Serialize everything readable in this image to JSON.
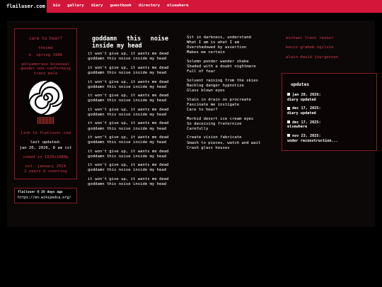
{
  "header": {
    "brand": "flailuser.com",
    "nav": [
      "bio",
      "gallery",
      "diary",
      "guestbook",
      "directory",
      "elsewhere"
    ]
  },
  "profile": {
    "tagline": "care to hear?",
    "name": "thesmd",
    "born": "b. spring 1996",
    "identity": [
      "polyamorous bisexual",
      "gender non-conforming",
      "trans male"
    ],
    "link": "link to flailuser.com",
    "last_updated_label": "last updated:",
    "last_updated": "jan 20, 2026, 8 am cst",
    "coded": "coded in 1920x1080p",
    "est": [
      "est. january 2024",
      "2 years & counting"
    ]
  },
  "chat": {
    "author": "flailuser",
    "age": "25 days ago",
    "url": "https://en.wikipedia.org/"
  },
  "poem": {
    "title": "goddamn this noise inside my head",
    "refrain_a": "it won't give up, it wants me dead",
    "refrain_b": "goddamn this noise inside my head",
    "count": 10
  },
  "lyrics": [
    [
      "Sit in darkness, understand",
      "What I am is what I am",
      "Overshadowed by assertion",
      "Makes me certain"
    ],
    [
      "Solemn ponder wander shake",
      "Shaded with a doubt nightmare",
      "Full of fear"
    ],
    [
      "Solvent raining from the skies",
      "Backlog danger hypnotize",
      "Glass blown eyes"
    ],
    [
      "Stain in drain on procreate",
      "Fascinate me instigate",
      "Care to hear?"
    ],
    [
      "Morbid desert ice cream eyes",
      "So deceiving fraternize",
      "Carefully"
    ],
    [
      "Create vision fabricate",
      "Smash to pieces, watch and wait",
      "Crash glass houses"
    ]
  ],
  "names": [
    "michael trent reznor",
    "kevin grahem ogilvie",
    "alain david jourgensen"
  ],
  "updates": {
    "title": "updates",
    "items": [
      {
        "date": "jan 20, 2026:",
        "text": "diary updated"
      },
      {
        "date": "dec 17, 2025:",
        "text": "diary updated"
      },
      {
        "date": "dec 17, 2025:",
        "text": "elsewhere"
      },
      {
        "date": "nov 23, 2025:",
        "text": "under reconstruction..."
      }
    ]
  },
  "colors": {
    "accent": "#d4163a",
    "border": "#8b1a25",
    "text_red": "#d33a4a"
  }
}
